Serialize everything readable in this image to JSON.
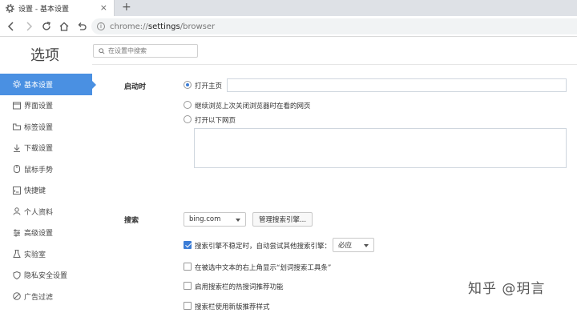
{
  "browser": {
    "tab_title": "设置 - 基本设置",
    "tab_close": "×",
    "new_tab": "+",
    "url_host": "chrome://",
    "url_path": "settings",
    "url_tail": "/browser"
  },
  "sidebar": {
    "title": "选项",
    "items": [
      {
        "label": "基本设置",
        "icon": "gear-icon",
        "active": true
      },
      {
        "label": "界面设置",
        "icon": "window-icon"
      },
      {
        "label": "标签设置",
        "icon": "tab-icon"
      },
      {
        "label": "下载设置",
        "icon": "download-icon"
      },
      {
        "label": "鼠标手势",
        "icon": "mouse-icon"
      },
      {
        "label": "快捷键",
        "icon": "keyboard-icon"
      },
      {
        "label": "个人资料",
        "icon": "person-icon"
      },
      {
        "label": "高级设置",
        "icon": "advanced-icon"
      },
      {
        "label": "实验室",
        "icon": "lab-icon"
      },
      {
        "label": "隐私安全设置",
        "icon": "shield-icon"
      },
      {
        "label": "广告过滤",
        "icon": "block-icon"
      }
    ]
  },
  "search": {
    "placeholder": "在设置中搜索"
  },
  "startup": {
    "label": "启动时",
    "opt_home": "打开主页",
    "opt_continue": "继续浏览上次关闭浏览器时在看的网页",
    "opt_pages": "打开以下网页"
  },
  "search_engine": {
    "label": "搜索",
    "engine": "bing.com",
    "manage_button": "管理搜索引擎...",
    "fallback_text": "搜索引擎不稳定时，自动尝试其他搜索引擎：",
    "fallback_engine": "必应",
    "opt_toolbar": "在被选中文本的右上角显示“划词搜索工具条”",
    "opt_hot": "启用搜索栏的热搜词推荐功能",
    "opt_new_style": "搜索栏使用新版推荐样式"
  },
  "watermark": "知乎 @玥言",
  "colors": {
    "accent": "#4a90e2",
    "check": "#3c7dd6"
  }
}
